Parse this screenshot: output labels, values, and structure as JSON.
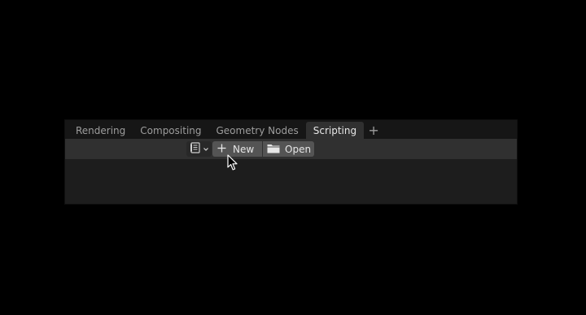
{
  "workspace_tabs": [
    {
      "label": "Rendering",
      "active": false
    },
    {
      "label": "Compositing",
      "active": false
    },
    {
      "label": "Geometry Nodes",
      "active": false
    },
    {
      "label": "Scripting",
      "active": true
    }
  ],
  "add_tab_glyph": "+",
  "header": {
    "editor_type_icon": "text-editor-icon",
    "new_label": "New",
    "new_icon": "plus-icon",
    "open_label": "Open",
    "open_icon": "folder-icon"
  },
  "colors": {
    "background": "#000000",
    "tabbar": "#161616",
    "active_tab": "#303030",
    "header": "#303030",
    "button": "#545454",
    "editor": "#1d1d1d"
  }
}
